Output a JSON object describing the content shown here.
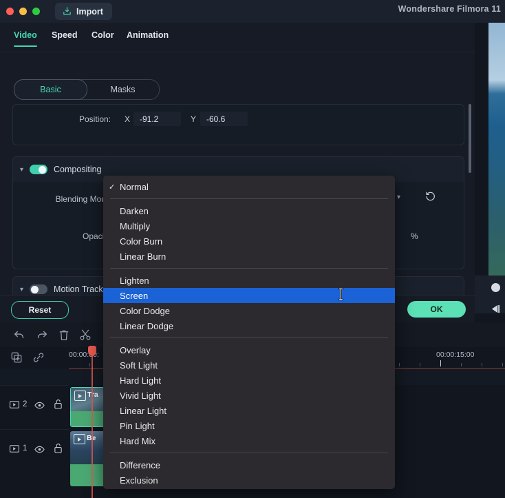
{
  "window": {
    "title": "Wondershare Filmora 11",
    "import_label": "Import",
    "traffic_lights": [
      "close-red",
      "minimize-yellow",
      "maximize-green"
    ]
  },
  "editor": {
    "tabs": [
      {
        "label": "Video",
        "active": true
      },
      {
        "label": "Speed",
        "active": false
      },
      {
        "label": "Color",
        "active": false
      },
      {
        "label": "Animation",
        "active": false
      }
    ],
    "segmented": [
      {
        "label": "Basic",
        "active": true
      },
      {
        "label": "Masks",
        "active": false
      }
    ],
    "position": {
      "label": "Position:",
      "x_axis": "X",
      "x_value": "-91.2",
      "y_axis": "Y",
      "y_value": "-60.6"
    },
    "compositing": {
      "title": "Compositing",
      "enabled": true,
      "blending_mode_label": "Blending Mode:",
      "blending_mode_value": "Normal",
      "opacity_label": "Opacity:",
      "opacity_unit": "%",
      "reset_icon": "reset-circular-arrow-icon"
    },
    "motion_tracking": {
      "title": "Motion Tracki",
      "enabled": false
    },
    "actions": {
      "reset_label": "Reset",
      "ok_label": "OK"
    }
  },
  "preview": {
    "play_icon": "step-back-play-icon",
    "slider_knob": "volume-slider-knob"
  },
  "toolbar": {
    "icons": [
      "undo-icon",
      "redo-icon",
      "delete-icon",
      "split-scissors-icon"
    ]
  },
  "timeline": {
    "head_icons": [
      "add-track-icon",
      "link-icon"
    ],
    "timecode_left": "00:00:00:",
    "timecode_right": "00:00:15:00",
    "tracks": [
      {
        "number": "2",
        "eye_icon": "eye-icon",
        "lock_icon": "unlock-icon",
        "clip_name": "Tra"
      },
      {
        "number": "1",
        "eye_icon": "eye-icon",
        "lock_icon": "unlock-icon",
        "clip_name": "Be"
      }
    ]
  },
  "blend_menu": {
    "selected_item": "Screen",
    "checked_item": "Normal",
    "groups": [
      [
        "Normal"
      ],
      [
        "Darken",
        "Multiply",
        "Color Burn",
        "Linear Burn"
      ],
      [
        "Lighten",
        "Screen",
        "Color Dodge",
        "Linear Dodge"
      ],
      [
        "Overlay",
        "Soft Light",
        "Hard Light",
        "Vivid Light",
        "Linear Light",
        "Pin Light",
        "Hard Mix"
      ],
      [
        "Difference",
        "Exclusion"
      ]
    ],
    "items": [
      "Normal",
      "Darken",
      "Multiply",
      "Color Burn",
      "Linear Burn",
      "Lighten",
      "Screen",
      "Color Dodge",
      "Linear Dodge",
      "Overlay",
      "Soft Light",
      "Hard Light",
      "Vivid Light",
      "Linear Light",
      "Pin Light",
      "Hard Mix",
      "Difference",
      "Exclusion"
    ]
  },
  "colors": {
    "accent": "#3ecfae",
    "menu_highlight": "#1a62d6",
    "playhead": "#e8594f",
    "panel_bg": "#161b25",
    "menu_bg": "#2c2a2e"
  }
}
